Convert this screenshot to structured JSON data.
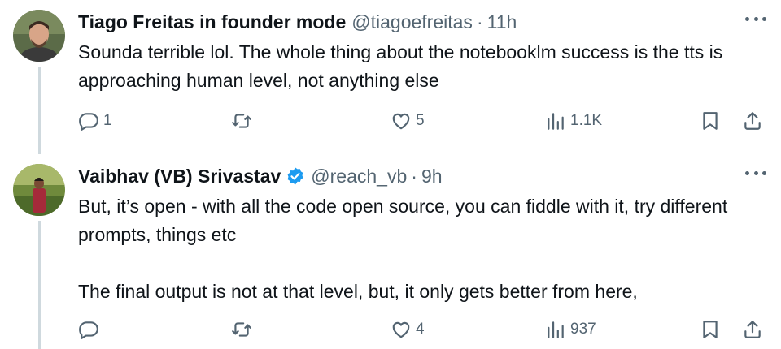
{
  "tweets": [
    {
      "author_name": "Tiago Freitas in founder mode",
      "handle": "@tiagoefreitas",
      "separator": "·",
      "time": "11h",
      "verified": false,
      "paragraphs": [
        "Sounda terrible lol. The whole thing about the notebooklm success is the tts is approaching human level, not anything else"
      ],
      "reply_count": "1",
      "retweet_count": "",
      "like_count": "5",
      "view_count": "1.1K"
    },
    {
      "author_name": "Vaibhav (VB) Srivastav",
      "handle": "@reach_vb",
      "separator": "·",
      "time": "9h",
      "verified": true,
      "paragraphs": [
        "But, it’s open - with all the code open source, you can fiddle with it, try different prompts, things etc",
        "The final output is not at that level, but, it only gets better from here,"
      ],
      "reply_count": "",
      "retweet_count": "",
      "like_count": "4",
      "view_count": "937"
    }
  ],
  "icons": {
    "reply": "reply-icon",
    "retweet": "retweet-icon",
    "like": "heart-icon",
    "views": "views-icon",
    "bookmark": "bookmark-icon",
    "share": "share-icon",
    "more": "more-icon",
    "verified": "verified-badge-icon"
  },
  "colors": {
    "text": "#0f1419",
    "secondary": "#536471",
    "verified": "#1d9bf0",
    "thread_line": "#cfd9de"
  }
}
